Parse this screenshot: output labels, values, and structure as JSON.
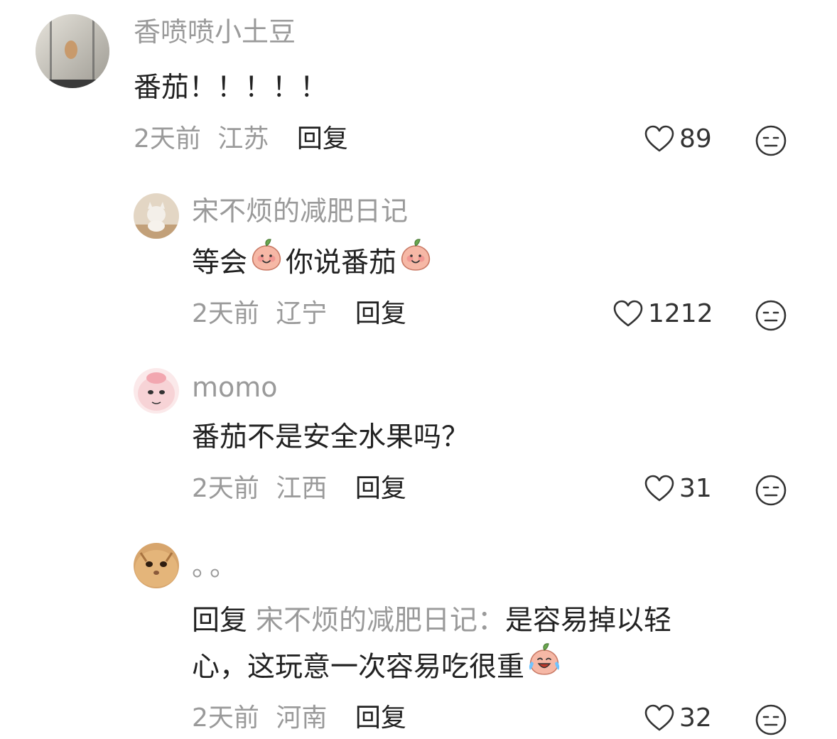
{
  "comments": [
    {
      "username": "香喷喷小土豆",
      "text": "番茄！！！！！",
      "time": "2天前",
      "location": "江苏",
      "reply_label": "回复",
      "likes": "89"
    },
    {
      "username": "宋不烦的减肥日记",
      "text_a": "等会",
      "text_b": "你说番茄",
      "time": "2天前",
      "location": "辽宁",
      "reply_label": "回复",
      "likes": "1212"
    },
    {
      "username": "momo",
      "text": "番茄不是安全水果吗？",
      "time": "2天前",
      "location": "江西",
      "reply_label": "回复",
      "likes": "31"
    },
    {
      "username": "。。",
      "reply_prefix": "回复",
      "reply_target": "宋不烦的减肥日记：",
      "text_line1": "是容易掉以轻",
      "text_line2": "心，这玩意一次容易吃很重",
      "time": "2天前",
      "location": "河南",
      "reply_label": "回复",
      "likes": "32"
    }
  ],
  "icons": {
    "like": "heart-outline-icon",
    "dislike": "neutral-face-icon",
    "emoji_smile": "peach-smile-emoji",
    "emoji_cry": "peach-laugh-cry-emoji"
  },
  "colors": {
    "username": "#9a9a9a",
    "text": "#222222",
    "meta": "#9a9a9a",
    "background": "#ffffff"
  }
}
